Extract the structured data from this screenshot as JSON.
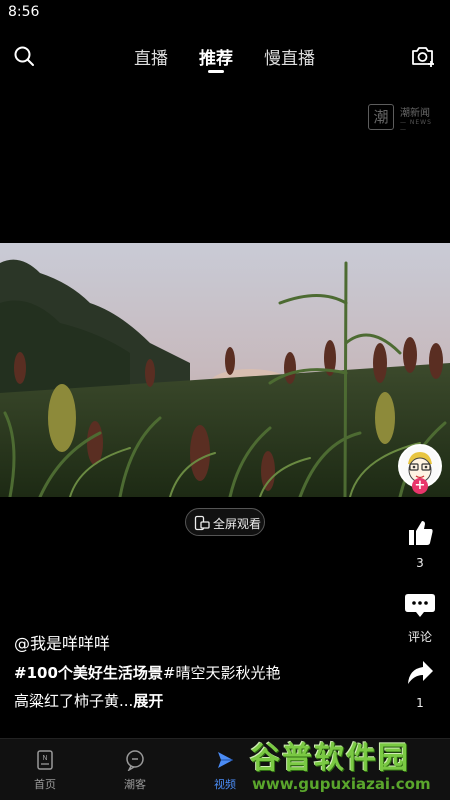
{
  "status": {
    "time": "8:56"
  },
  "nav": {
    "tabs": [
      {
        "label": "直播",
        "active": false
      },
      {
        "label": "推荐",
        "active": true
      },
      {
        "label": "慢直播",
        "active": false
      }
    ]
  },
  "watermark": {
    "logo_char": "潮",
    "name": "潮新闻",
    "sub": "— NEWS —"
  },
  "player": {
    "fullscreen_label": "全屏观看"
  },
  "actions": {
    "like_count": "3",
    "comment_label": "评论",
    "share_count": "1"
  },
  "post": {
    "author": "@我是咩咩咩",
    "tag1": "#100个美好生活场景",
    "tag2": "#晴空天影秋光艳",
    "text": "高粱红了柿子黄...",
    "expand_label": "展开"
  },
  "bottom_nav": {
    "items": [
      {
        "label": "首页",
        "icon": "news-icon",
        "active": false
      },
      {
        "label": "潮客",
        "icon": "chat-icon",
        "active": false
      },
      {
        "label": "视频",
        "icon": "play-icon",
        "active": true
      }
    ]
  },
  "site_watermark": {
    "title": "谷普软件园",
    "url": "www.gupuxiazai.com"
  },
  "colors": {
    "accent_blue": "#4b8cf5",
    "follow_pink": "#e8356b",
    "watermark_green": "#7ac943"
  }
}
